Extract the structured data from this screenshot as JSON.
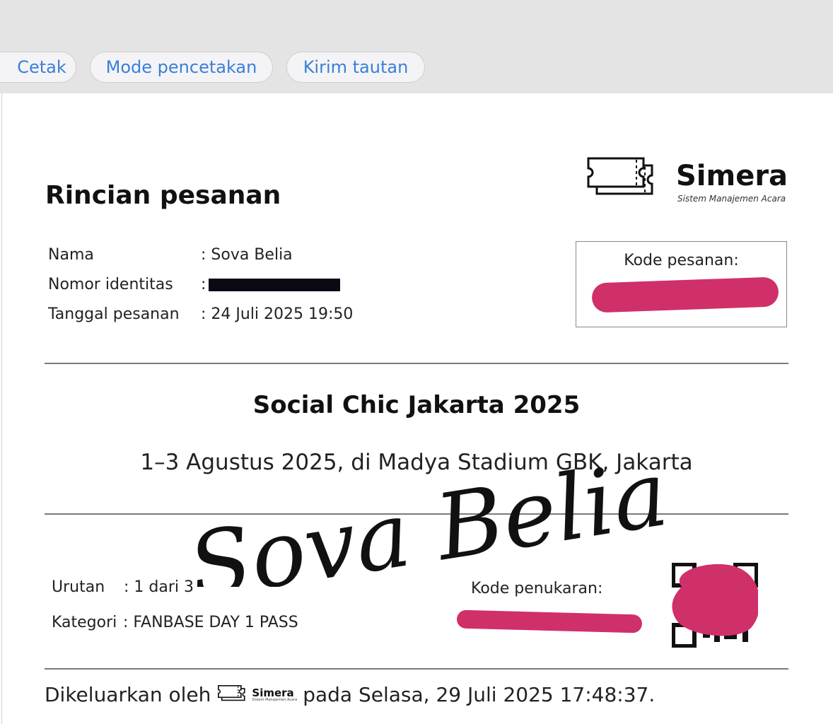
{
  "toolbar": {
    "print_label": "Cetak",
    "print_mode_label": "Mode pencetakan",
    "send_link_label": "Kirim tautan"
  },
  "brand": {
    "name": "Simera",
    "tagline": "Sistem Manajemen Acara"
  },
  "order_details": {
    "title": "Rincian pesanan",
    "name_label": "Nama",
    "name_value": ": Sova Belia",
    "id_label": "Nomor identitas",
    "id_value": ":",
    "date_label": "Tanggal pesanan",
    "date_value": ": 24 Juli 2025 19:50",
    "order_code_label": "Kode pesanan:"
  },
  "event": {
    "title": "Social Chic Jakarta 2025",
    "subtitle": "1–3 Agustus 2025, di Madya Stadium GBK, Jakarta"
  },
  "signature_text": "Sova Belia",
  "ticket": {
    "order_label": "Urutan",
    "order_value": ": 1 dari 3",
    "category_label": "Kategori",
    "category_value": ": FANBASE DAY 1 PASS",
    "redeem_label": "Kode penukaran:"
  },
  "footer": {
    "issued_prefix": "Dikeluarkan oleh",
    "issued_suffix": "pada Selasa, 29 Juli 2025  17:48:37."
  },
  "colors": {
    "accent_blue": "#3a7fd9",
    "redaction_pink": "#d0306a"
  }
}
